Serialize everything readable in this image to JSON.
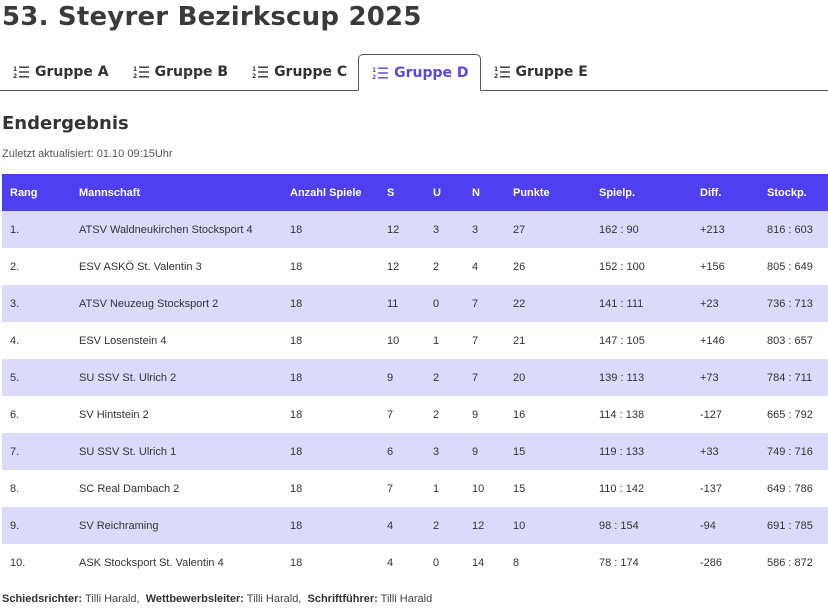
{
  "title": "53. Steyrer Bezirkscup 2025",
  "tabs": [
    {
      "label": "Gruppe A",
      "active": false
    },
    {
      "label": "Gruppe B",
      "active": false
    },
    {
      "label": "Gruppe C",
      "active": false
    },
    {
      "label": "Gruppe D",
      "active": true
    },
    {
      "label": "Gruppe E",
      "active": false
    }
  ],
  "section_title": "Endergebnis",
  "updated": "Zuletzt aktualisiert: 01.10 09:15Uhr",
  "colors": {
    "accent": "#5a48e0",
    "header_bg": "#4f3ff0",
    "row_alt": "#dcdafa"
  },
  "icons": {
    "tab": "numbered-list-icon"
  },
  "table": {
    "headers": [
      "Rang",
      "Mannschaft",
      "Anzahl Spiele",
      "S",
      "U",
      "N",
      "Punkte",
      "Spielp.",
      "Diff.",
      "Stockp."
    ],
    "rows": [
      [
        "1.",
        "ATSV Waldneukirchen Stocksport 4",
        "18",
        "12",
        "3",
        "3",
        "27",
        "162 : 90",
        "+213",
        "816 : 603"
      ],
      [
        "2.",
        "ESV ASKÖ St. Valentin 3",
        "18",
        "12",
        "2",
        "4",
        "26",
        "152 : 100",
        "+156",
        "805 : 649"
      ],
      [
        "3.",
        "ATSV Neuzeug Stocksport 2",
        "18",
        "11",
        "0",
        "7",
        "22",
        "141 : 111",
        "+23",
        "736 : 713"
      ],
      [
        "4.",
        "ESV Losenstein 4",
        "18",
        "10",
        "1",
        "7",
        "21",
        "147 : 105",
        "+146",
        "803 : 657"
      ],
      [
        "5.",
        "SU SSV St. Ulrich 2",
        "18",
        "9",
        "2",
        "7",
        "20",
        "139 : 113",
        "+73",
        "784 : 711"
      ],
      [
        "6.",
        "SV Hintstein 2",
        "18",
        "7",
        "2",
        "9",
        "16",
        "114 : 138",
        "-127",
        "665 : 792"
      ],
      [
        "7.",
        "SU SSV St. Ulrich 1",
        "18",
        "6",
        "3",
        "9",
        "15",
        "119 : 133",
        "+33",
        "749 : 716"
      ],
      [
        "8.",
        "SC Real Dambach 2",
        "18",
        "7",
        "1",
        "10",
        "15",
        "110 : 142",
        "-137",
        "649 : 786"
      ],
      [
        "9.",
        "SV Reichraming",
        "18",
        "4",
        "2",
        "12",
        "10",
        "98 : 154",
        "-94",
        "691 : 785"
      ],
      [
        "10.",
        "ASK Stocksport St. Valentin 4",
        "18",
        "4",
        "0",
        "14",
        "8",
        "78 : 174",
        "-286",
        "586 : 872"
      ]
    ]
  },
  "footer": {
    "referee_label": "Schiedsrichter:",
    "referee": "Tilli Harald,",
    "director_label": "Wettbewerbsleiter:",
    "director": "Tilli Harald,",
    "recorder_label": "Schriftführer:",
    "recorder": "Tilli Harald"
  }
}
